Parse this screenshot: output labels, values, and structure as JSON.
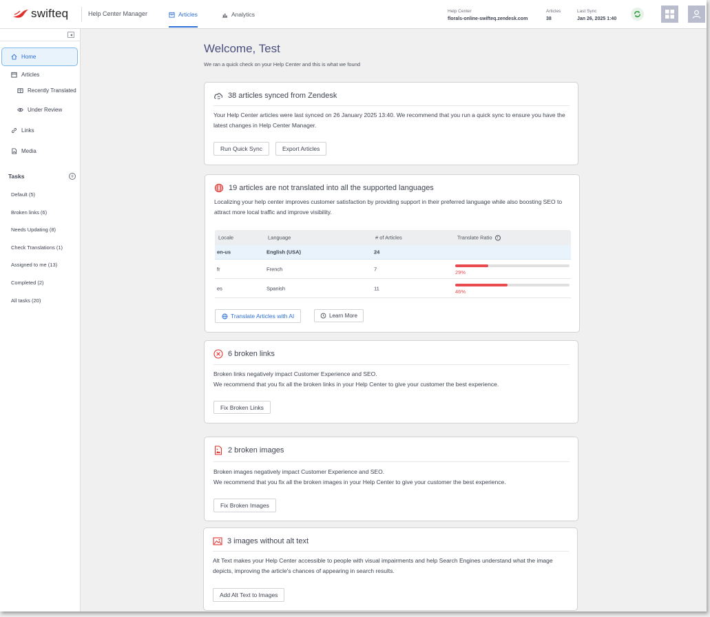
{
  "header": {
    "logo_text": "swifteq",
    "app_name": "Help Center Manager",
    "tabs": [
      {
        "label": "Articles",
        "active": true,
        "icon": "calendar-icon"
      },
      {
        "label": "Analytics",
        "active": false,
        "icon": "bar-chart-icon"
      }
    ],
    "help_center_label": "Help Center",
    "help_center_value": "florals-online-swifteq.zendesk.com",
    "articles_label": "Articles",
    "articles_value": "38",
    "last_sync_label": "Last Sync",
    "last_sync_value": "Jan 26, 2025 1:40",
    "colors": {
      "accent": "#2d6fd6",
      "logo_red": "#e0312e",
      "sync_green": "#3aa14a",
      "avatar_bg": "#b9bccd"
    }
  },
  "sidebar": {
    "nav": [
      {
        "label": "Home",
        "icon": "home-icon",
        "active": true
      },
      {
        "label": "Articles",
        "icon": "calendar-icon"
      },
      {
        "label": "Recently Translated",
        "icon": "translate-icon"
      },
      {
        "label": "Under Review",
        "icon": "eye-icon"
      },
      {
        "label": "Links",
        "icon": "link-icon"
      },
      {
        "label": "Media",
        "icon": "image-file-icon"
      }
    ],
    "tasks_label": "Tasks",
    "tasks": [
      "Default (5)",
      "Broken links (6)",
      "Needs Updating (8)",
      "Check Translations (1)",
      "Assigned to me (13)",
      "Completed (2)",
      "All tasks (20)"
    ]
  },
  "main": {
    "title": "Welcome, Test",
    "subtitle": "We ran a quick check on your Help Center and this is what we found",
    "sync_card": {
      "title": "38 articles synced from Zendesk",
      "body": "Your Help Center articles were last synced on 26 January 2025 13:40. We recommend that you run a quick sync to ensure you have the latest changes in Help Center Manager.",
      "btn_sync": "Run Quick Sync",
      "btn_export": "Export Articles"
    },
    "translate_card": {
      "title": "19 articles are not translated into all the supported languages",
      "body": "Localizing your help center improves customer satisfaction by providing support in their preferred language while also boosting SEO to attract more local traffic and improve visibility.",
      "columns": [
        "Locale",
        "Language",
        "# of Articles",
        "Translate Ratio"
      ],
      "rows": [
        {
          "locale": "en-us",
          "language": "English (USA)",
          "articles": "24",
          "ratio": null,
          "ratio_label": ""
        },
        {
          "locale": "fr",
          "language": "French",
          "articles": "7",
          "ratio": 29,
          "ratio_label": "29%"
        },
        {
          "locale": "es",
          "language": "Spanish",
          "articles": "11",
          "ratio": 46,
          "ratio_label": "46%"
        }
      ],
      "btn_translate": "Translate Articles with AI",
      "btn_learn": "Learn More"
    },
    "links_card": {
      "title": "6 broken links",
      "body1": "Broken links negatively impact Customer Experience and SEO.",
      "body2": "We recommend that you fix all the broken links in your Help Center to give your customer the best experience.",
      "btn": "Fix Broken Links"
    },
    "images_card": {
      "title": "2 broken images",
      "body1": "Broken images negatively impact Customer Experience and SEO.",
      "body2": "We recommend that you fix all the broken images in your Help Center to give your customer the best experience.",
      "btn": "Fix Broken Images"
    },
    "alt_card": {
      "title": "3 images without alt text",
      "body": "Alt Text makes your Help Center accessible to people with visual impairments and help Search Engines understand what the image depicts, improving the article's chances of appearing in search results.",
      "btn": "Add Alt Text to Images"
    }
  }
}
